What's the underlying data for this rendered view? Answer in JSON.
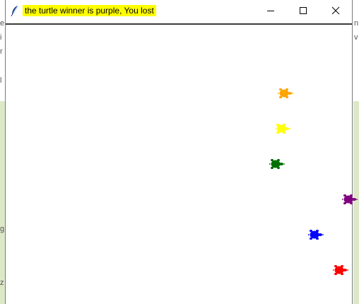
{
  "window": {
    "title": "the turtle winner is purple, You lost",
    "title_highlight_color": "#ffff00",
    "icon": "feather-icon",
    "controls": [
      "minimize-icon",
      "maximize-icon",
      "close-icon"
    ]
  },
  "background_window": {
    "visible_chars": [
      "e",
      "i",
      "r",
      "l",
      "g",
      "z",
      "n",
      "v"
    ]
  },
  "race": {
    "winner": "purple",
    "turtles": [
      {
        "color": "orange",
        "hex": "#ffa500"
      },
      {
        "color": "yellow",
        "hex": "#ffff00"
      },
      {
        "color": "green",
        "hex": "#007000"
      },
      {
        "color": "purple",
        "hex": "#800080"
      },
      {
        "color": "blue",
        "hex": "#0000ff"
      },
      {
        "color": "red",
        "hex": "#ff0000"
      }
    ]
  }
}
